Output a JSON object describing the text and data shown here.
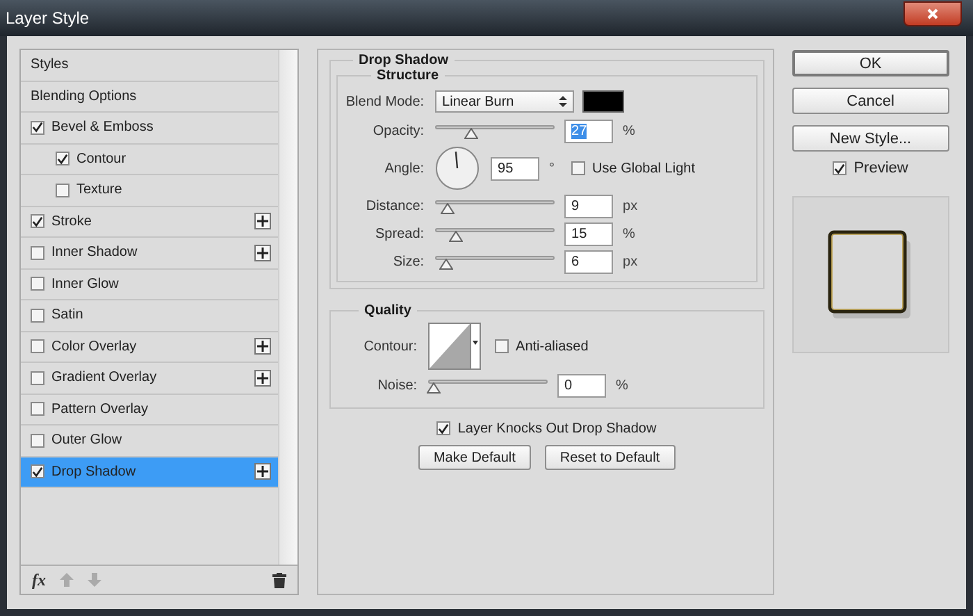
{
  "window": {
    "title": "Layer Style"
  },
  "styles_list": [
    {
      "label": "Styles",
      "kind": "plain",
      "selected": false,
      "add_button": false
    },
    {
      "label": "Blending Options",
      "kind": "plain",
      "selected": false,
      "add_button": false
    },
    {
      "label": "Bevel & Emboss",
      "kind": "check",
      "checked": true,
      "selected": false,
      "add_button": false,
      "children": [
        {
          "label": "Contour",
          "kind": "check",
          "checked": true,
          "selected": false,
          "add_button": false
        },
        {
          "label": "Texture",
          "kind": "check",
          "checked": false,
          "selected": false,
          "add_button": false
        }
      ]
    },
    {
      "label": "Stroke",
      "kind": "check",
      "checked": true,
      "selected": false,
      "add_button": true
    },
    {
      "label": "Inner Shadow",
      "kind": "check",
      "checked": false,
      "selected": false,
      "add_button": true
    },
    {
      "label": "Inner Glow",
      "kind": "check",
      "checked": false,
      "selected": false,
      "add_button": false
    },
    {
      "label": "Satin",
      "kind": "check",
      "checked": false,
      "selected": false,
      "add_button": false
    },
    {
      "label": "Color Overlay",
      "kind": "check",
      "checked": false,
      "selected": false,
      "add_button": true
    },
    {
      "label": "Gradient Overlay",
      "kind": "check",
      "checked": false,
      "selected": false,
      "add_button": true
    },
    {
      "label": "Pattern Overlay",
      "kind": "check",
      "checked": false,
      "selected": false,
      "add_button": false
    },
    {
      "label": "Outer Glow",
      "kind": "check",
      "checked": false,
      "selected": false,
      "add_button": false
    },
    {
      "label": "Drop Shadow",
      "kind": "check",
      "checked": true,
      "selected": true,
      "add_button": true
    }
  ],
  "list_toolbar": {
    "fx_label": "fx"
  },
  "panel": {
    "title": "Drop Shadow",
    "structure": {
      "title": "Structure",
      "rows": [
        {
          "kind": "blend",
          "label": "Blend Mode:",
          "value": "Linear Burn",
          "color": "#000000"
        },
        {
          "kind": "slider",
          "label": "Opacity:",
          "level": 0.26,
          "value": "27",
          "value_selected": true,
          "unit": "%"
        },
        {
          "kind": "angle",
          "label": "Angle:",
          "value": "95",
          "unit": "°",
          "checkbox": {
            "label": "Use Global Light",
            "checked": false
          }
        },
        {
          "kind": "slider",
          "label": "Distance:",
          "level": 0.06,
          "value": "9",
          "value_selected": false,
          "unit": "px"
        },
        {
          "kind": "slider",
          "label": "Spread:",
          "level": 0.13,
          "value": "15",
          "value_selected": false,
          "unit": "%"
        },
        {
          "kind": "slider",
          "label": "Size:",
          "level": 0.05,
          "value": "6",
          "value_selected": false,
          "unit": "px"
        }
      ]
    },
    "quality": {
      "title": "Quality",
      "rows": [
        {
          "kind": "contour",
          "label": "Contour:",
          "checkbox": {
            "label": "Anti-aliased",
            "checked": false
          }
        },
        {
          "kind": "slider",
          "label": "Noise:",
          "level": 0,
          "value": "0",
          "value_selected": false,
          "unit": "%"
        }
      ]
    },
    "knockout": {
      "label": "Layer Knocks Out Drop Shadow",
      "checked": true
    },
    "buttons": [
      "Make Default",
      "Reset to Default"
    ]
  },
  "side": {
    "buttons": [
      {
        "label": "OK",
        "default": true
      },
      {
        "label": "Cancel",
        "default": false
      },
      {
        "label": "New Style...",
        "default": false
      }
    ],
    "preview": {
      "label": "Preview",
      "checked": true
    }
  }
}
